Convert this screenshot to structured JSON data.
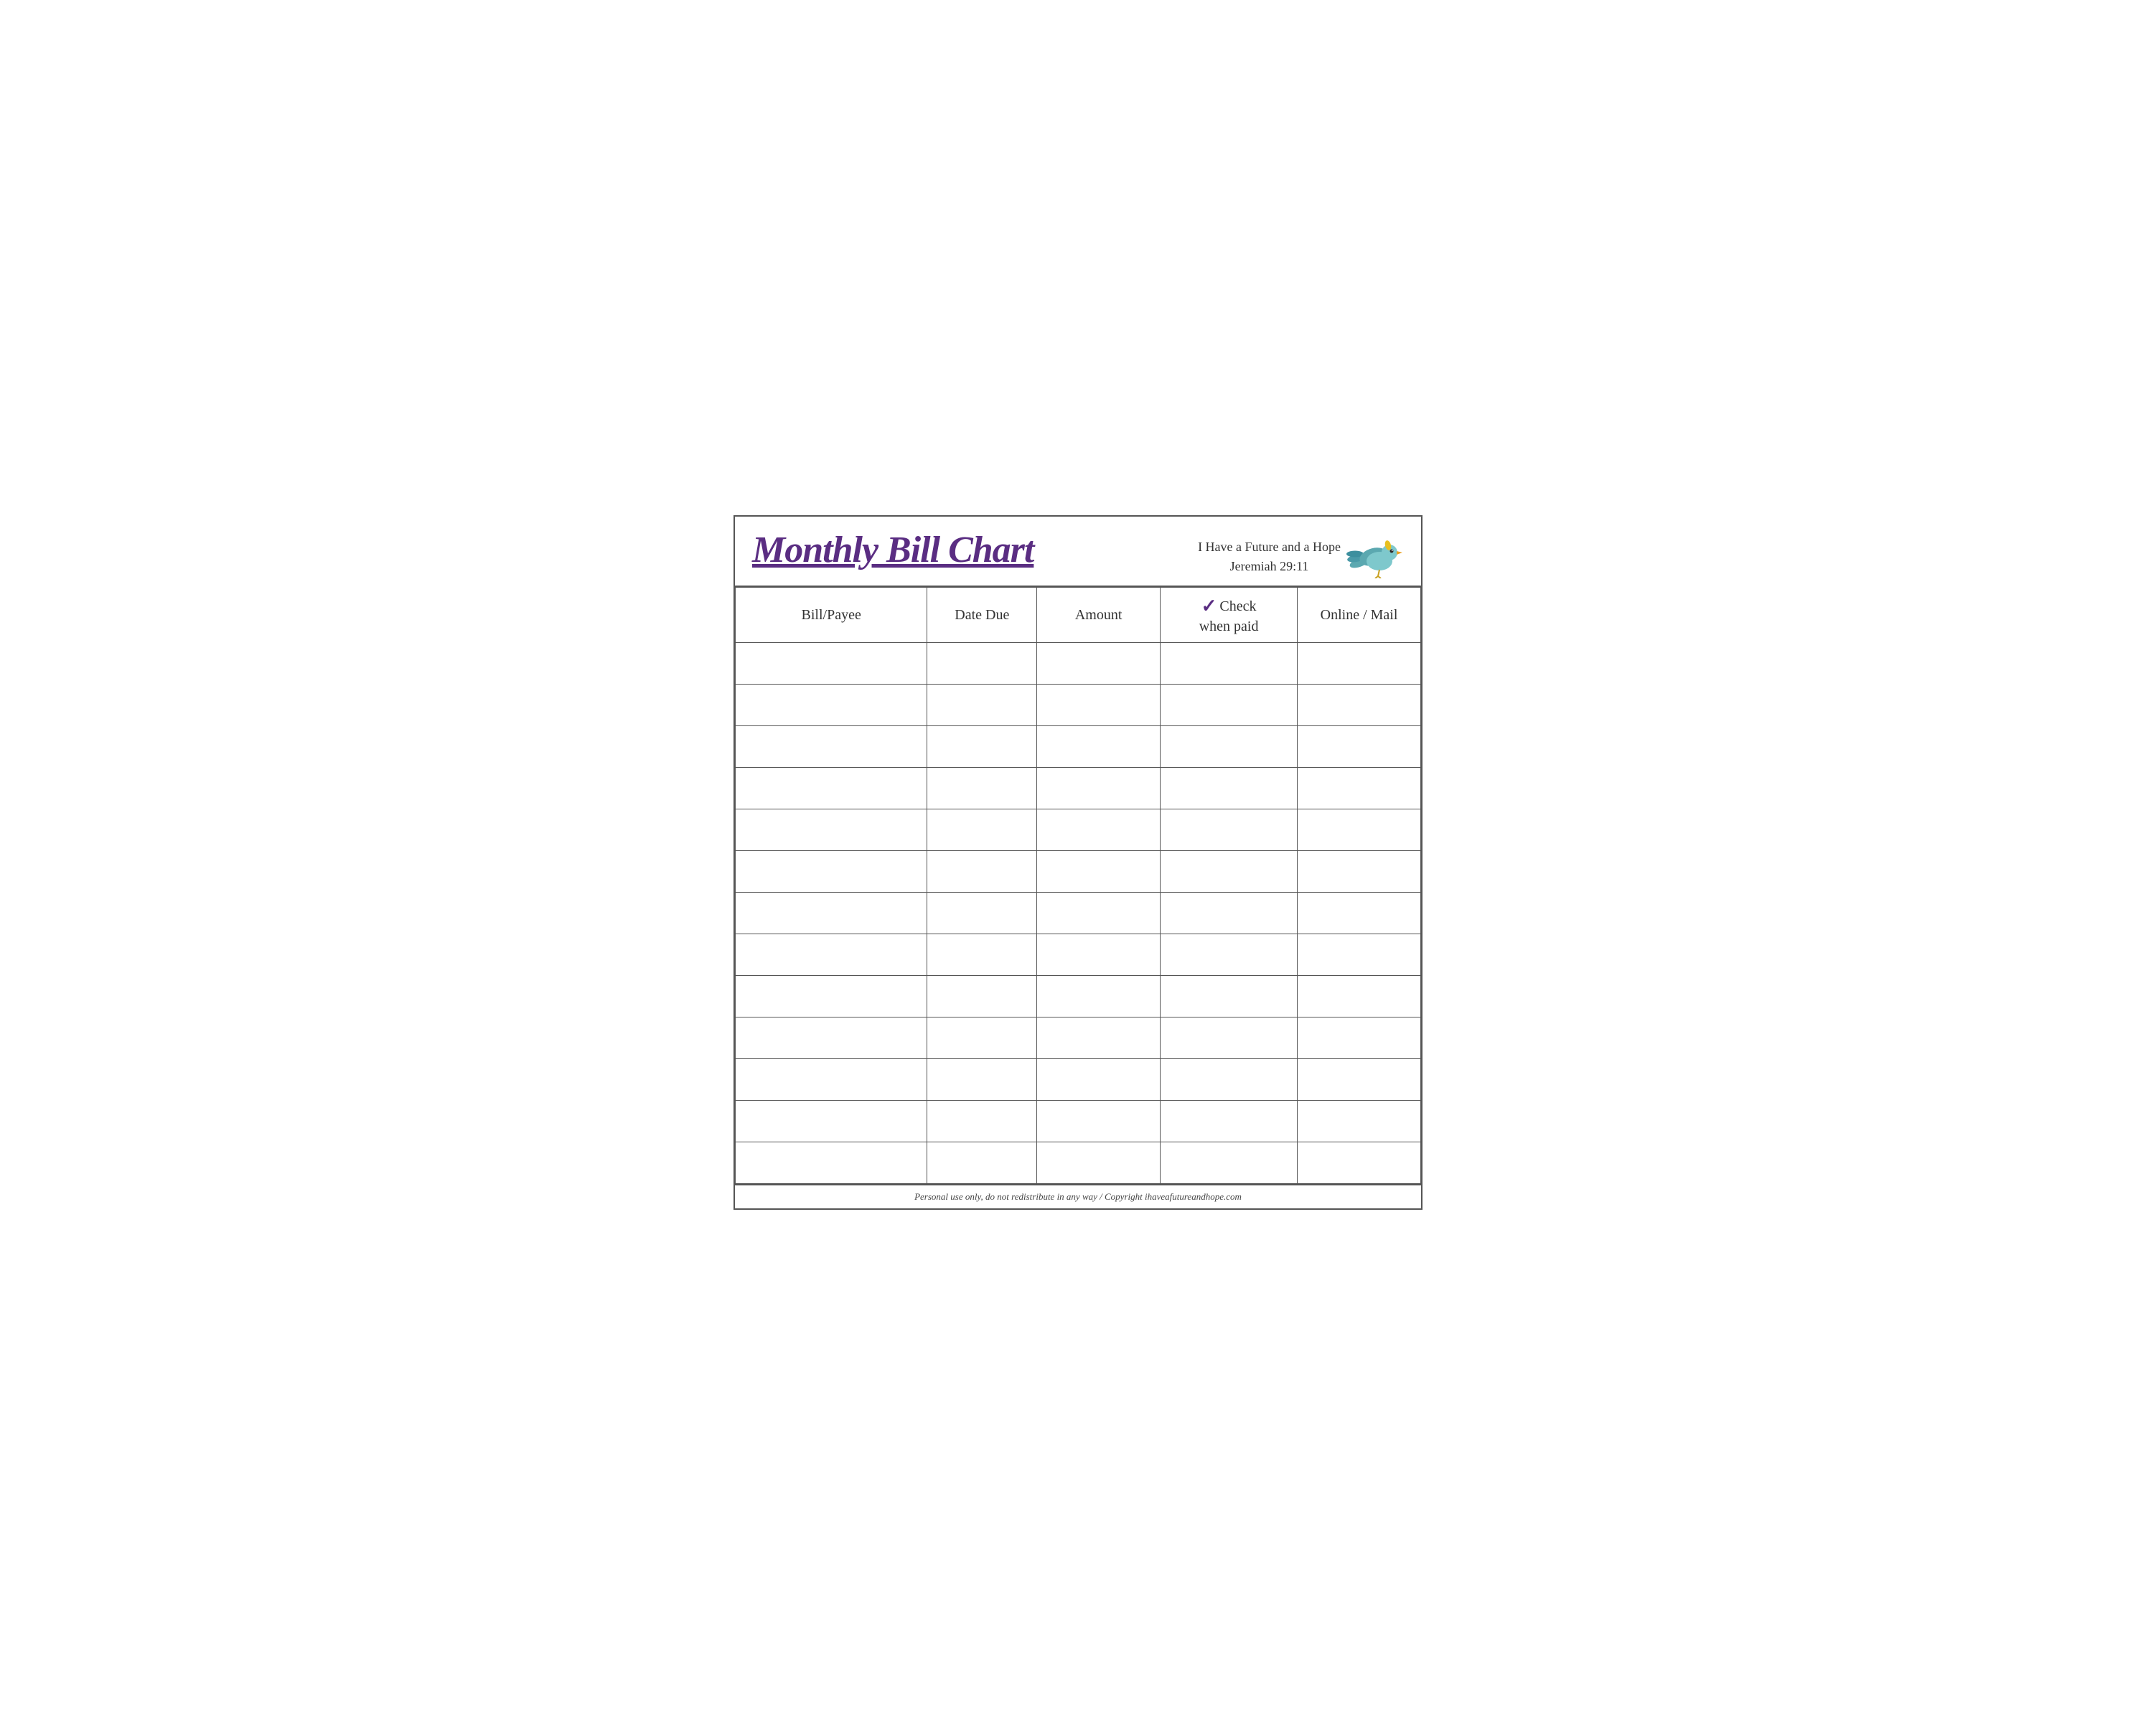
{
  "header": {
    "title": "Monthly Bill Chart",
    "subtitle_line1": "I Have a Future and a Hope",
    "subtitle_line2": "Jeremiah 29:11"
  },
  "table": {
    "columns": [
      {
        "id": "bill",
        "label": "Bill/Payee"
      },
      {
        "id": "date",
        "label": "Date Due"
      },
      {
        "id": "amount",
        "label": "Amount"
      },
      {
        "id": "check",
        "label_top": "Check",
        "label_bottom": "when paid"
      },
      {
        "id": "online",
        "label": "Online / Mail"
      }
    ],
    "row_count": 13
  },
  "footer": {
    "text": "Personal use only, do not redistribute in any way / Copyright ihaveafutureandhope.com"
  }
}
